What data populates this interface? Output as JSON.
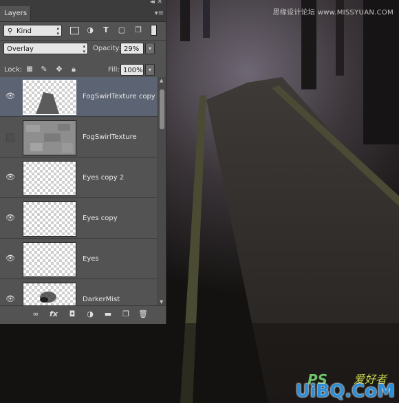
{
  "panel": {
    "tab_label": "Layers",
    "collapse_glyph": "◂◂",
    "close_glyph": "✕",
    "menu_glyph": "▾≡",
    "filter": {
      "kind_label": "Kind",
      "search_glyph": "⚲"
    },
    "filter_icons": [
      "image-filter-icon",
      "adjustment-filter-icon",
      "type-filter-icon",
      "shape-filter-icon",
      "smart-object-filter-icon"
    ],
    "blend_mode": "Overlay",
    "opacity_label": "Opacity:",
    "opacity_value": "29%",
    "lock_label": "Lock:",
    "fill_label": "Fill:",
    "fill_value": "100%",
    "dropdown_glyph": "▾",
    "layers": [
      {
        "name": "FogSwirlTexture copy",
        "visible": true,
        "selected": true,
        "thumb": "dark-shape"
      },
      {
        "name": "FogSwirlTexture",
        "visible": false,
        "selected": false,
        "thumb": "noise"
      },
      {
        "name": "Eyes copy 2",
        "visible": true,
        "selected": false,
        "thumb": "transparent"
      },
      {
        "name": "Eyes copy",
        "visible": true,
        "selected": false,
        "thumb": "transparent"
      },
      {
        "name": "Eyes",
        "visible": true,
        "selected": false,
        "thumb": "transparent"
      },
      {
        "name": "DarkerMist",
        "visible": true,
        "selected": false,
        "thumb": "mist"
      }
    ],
    "bottom_icons": {
      "link": "∞",
      "fx": "fx",
      "mask": "◘",
      "adjust": "◑",
      "group": "▬",
      "new": "❐",
      "delete": "🗑"
    }
  },
  "watermark": {
    "top_text": "思缘设计论坛 www.MISSYUAN.COM",
    "ps_text": "PS",
    "cn_text": "爱好者",
    "url_text": "UiBQ.CoM"
  }
}
